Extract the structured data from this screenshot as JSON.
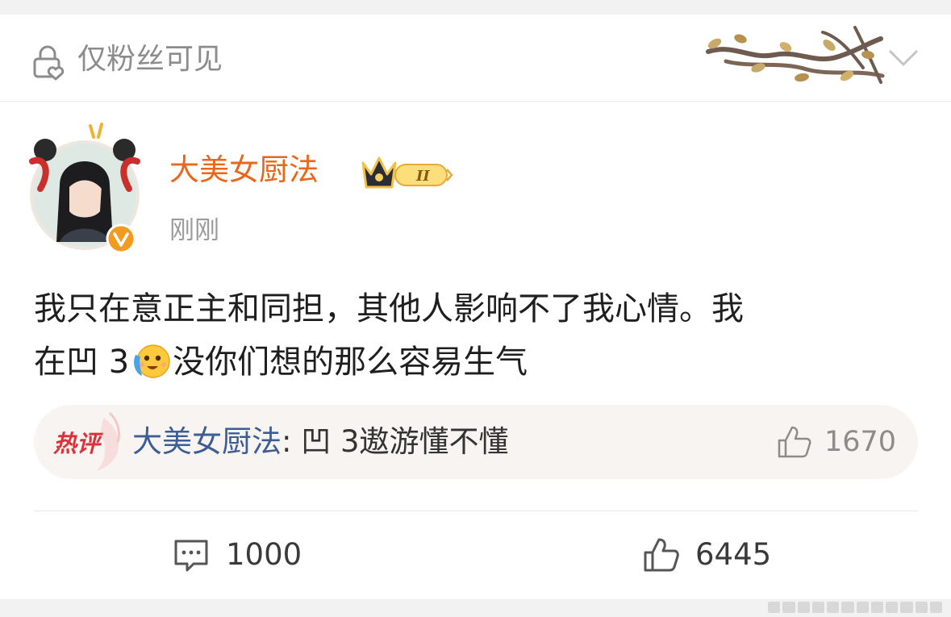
{
  "header": {
    "visibility_label": "仅粉丝可见",
    "lock_icon": "lock-heart-icon",
    "decoration": "branch-leaves-decoration",
    "menu_icon": "chevron-down-icon"
  },
  "post": {
    "author": "大美女厨法",
    "badge": "II",
    "time": "刚刚",
    "text_line1": "我只在意正主和同担，其他人影响不了我心情。我",
    "text_line2_prefix": "在凹 3",
    "text_line2_suffix": "没你们想的那么容易生气",
    "inline_emoji": "crying-smile-emoji"
  },
  "hot_comment": {
    "tag": "热评",
    "author": "大美女厨法",
    "separator": ": ",
    "text": "凹 3遨游懂不懂",
    "likes": "1670"
  },
  "actions": {
    "comments": "1000",
    "likes": "6445"
  },
  "colors": {
    "author": "#e8671a",
    "hot_author": "#3d5d95",
    "hot_tag": "#d9343b",
    "verified": "#f39b1e"
  }
}
